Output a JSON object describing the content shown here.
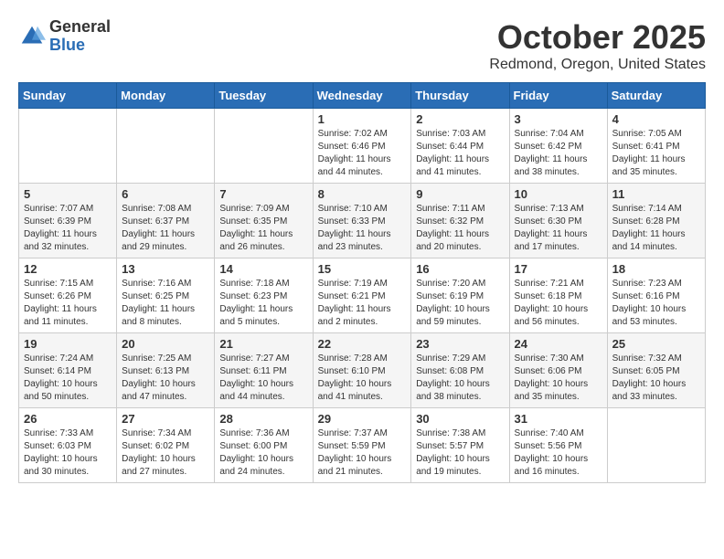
{
  "header": {
    "logo_general": "General",
    "logo_blue": "Blue",
    "month_title": "October 2025",
    "location": "Redmond, Oregon, United States"
  },
  "days_of_week": [
    "Sunday",
    "Monday",
    "Tuesday",
    "Wednesday",
    "Thursday",
    "Friday",
    "Saturday"
  ],
  "weeks": [
    [
      {
        "day": "",
        "sunrise": "",
        "sunset": "",
        "daylight": ""
      },
      {
        "day": "",
        "sunrise": "",
        "sunset": "",
        "daylight": ""
      },
      {
        "day": "",
        "sunrise": "",
        "sunset": "",
        "daylight": ""
      },
      {
        "day": "1",
        "sunrise": "Sunrise: 7:02 AM",
        "sunset": "Sunset: 6:46 PM",
        "daylight": "Daylight: 11 hours and 44 minutes."
      },
      {
        "day": "2",
        "sunrise": "Sunrise: 7:03 AM",
        "sunset": "Sunset: 6:44 PM",
        "daylight": "Daylight: 11 hours and 41 minutes."
      },
      {
        "day": "3",
        "sunrise": "Sunrise: 7:04 AM",
        "sunset": "Sunset: 6:42 PM",
        "daylight": "Daylight: 11 hours and 38 minutes."
      },
      {
        "day": "4",
        "sunrise": "Sunrise: 7:05 AM",
        "sunset": "Sunset: 6:41 PM",
        "daylight": "Daylight: 11 hours and 35 minutes."
      }
    ],
    [
      {
        "day": "5",
        "sunrise": "Sunrise: 7:07 AM",
        "sunset": "Sunset: 6:39 PM",
        "daylight": "Daylight: 11 hours and 32 minutes."
      },
      {
        "day": "6",
        "sunrise": "Sunrise: 7:08 AM",
        "sunset": "Sunset: 6:37 PM",
        "daylight": "Daylight: 11 hours and 29 minutes."
      },
      {
        "day": "7",
        "sunrise": "Sunrise: 7:09 AM",
        "sunset": "Sunset: 6:35 PM",
        "daylight": "Daylight: 11 hours and 26 minutes."
      },
      {
        "day": "8",
        "sunrise": "Sunrise: 7:10 AM",
        "sunset": "Sunset: 6:33 PM",
        "daylight": "Daylight: 11 hours and 23 minutes."
      },
      {
        "day": "9",
        "sunrise": "Sunrise: 7:11 AM",
        "sunset": "Sunset: 6:32 PM",
        "daylight": "Daylight: 11 hours and 20 minutes."
      },
      {
        "day": "10",
        "sunrise": "Sunrise: 7:13 AM",
        "sunset": "Sunset: 6:30 PM",
        "daylight": "Daylight: 11 hours and 17 minutes."
      },
      {
        "day": "11",
        "sunrise": "Sunrise: 7:14 AM",
        "sunset": "Sunset: 6:28 PM",
        "daylight": "Daylight: 11 hours and 14 minutes."
      }
    ],
    [
      {
        "day": "12",
        "sunrise": "Sunrise: 7:15 AM",
        "sunset": "Sunset: 6:26 PM",
        "daylight": "Daylight: 11 hours and 11 minutes."
      },
      {
        "day": "13",
        "sunrise": "Sunrise: 7:16 AM",
        "sunset": "Sunset: 6:25 PM",
        "daylight": "Daylight: 11 hours and 8 minutes."
      },
      {
        "day": "14",
        "sunrise": "Sunrise: 7:18 AM",
        "sunset": "Sunset: 6:23 PM",
        "daylight": "Daylight: 11 hours and 5 minutes."
      },
      {
        "day": "15",
        "sunrise": "Sunrise: 7:19 AM",
        "sunset": "Sunset: 6:21 PM",
        "daylight": "Daylight: 11 hours and 2 minutes."
      },
      {
        "day": "16",
        "sunrise": "Sunrise: 7:20 AM",
        "sunset": "Sunset: 6:19 PM",
        "daylight": "Daylight: 10 hours and 59 minutes."
      },
      {
        "day": "17",
        "sunrise": "Sunrise: 7:21 AM",
        "sunset": "Sunset: 6:18 PM",
        "daylight": "Daylight: 10 hours and 56 minutes."
      },
      {
        "day": "18",
        "sunrise": "Sunrise: 7:23 AM",
        "sunset": "Sunset: 6:16 PM",
        "daylight": "Daylight: 10 hours and 53 minutes."
      }
    ],
    [
      {
        "day": "19",
        "sunrise": "Sunrise: 7:24 AM",
        "sunset": "Sunset: 6:14 PM",
        "daylight": "Daylight: 10 hours and 50 minutes."
      },
      {
        "day": "20",
        "sunrise": "Sunrise: 7:25 AM",
        "sunset": "Sunset: 6:13 PM",
        "daylight": "Daylight: 10 hours and 47 minutes."
      },
      {
        "day": "21",
        "sunrise": "Sunrise: 7:27 AM",
        "sunset": "Sunset: 6:11 PM",
        "daylight": "Daylight: 10 hours and 44 minutes."
      },
      {
        "day": "22",
        "sunrise": "Sunrise: 7:28 AM",
        "sunset": "Sunset: 6:10 PM",
        "daylight": "Daylight: 10 hours and 41 minutes."
      },
      {
        "day": "23",
        "sunrise": "Sunrise: 7:29 AM",
        "sunset": "Sunset: 6:08 PM",
        "daylight": "Daylight: 10 hours and 38 minutes."
      },
      {
        "day": "24",
        "sunrise": "Sunrise: 7:30 AM",
        "sunset": "Sunset: 6:06 PM",
        "daylight": "Daylight: 10 hours and 35 minutes."
      },
      {
        "day": "25",
        "sunrise": "Sunrise: 7:32 AM",
        "sunset": "Sunset: 6:05 PM",
        "daylight": "Daylight: 10 hours and 33 minutes."
      }
    ],
    [
      {
        "day": "26",
        "sunrise": "Sunrise: 7:33 AM",
        "sunset": "Sunset: 6:03 PM",
        "daylight": "Daylight: 10 hours and 30 minutes."
      },
      {
        "day": "27",
        "sunrise": "Sunrise: 7:34 AM",
        "sunset": "Sunset: 6:02 PM",
        "daylight": "Daylight: 10 hours and 27 minutes."
      },
      {
        "day": "28",
        "sunrise": "Sunrise: 7:36 AM",
        "sunset": "Sunset: 6:00 PM",
        "daylight": "Daylight: 10 hours and 24 minutes."
      },
      {
        "day": "29",
        "sunrise": "Sunrise: 7:37 AM",
        "sunset": "Sunset: 5:59 PM",
        "daylight": "Daylight: 10 hours and 21 minutes."
      },
      {
        "day": "30",
        "sunrise": "Sunrise: 7:38 AM",
        "sunset": "Sunset: 5:57 PM",
        "daylight": "Daylight: 10 hours and 19 minutes."
      },
      {
        "day": "31",
        "sunrise": "Sunrise: 7:40 AM",
        "sunset": "Sunset: 5:56 PM",
        "daylight": "Daylight: 10 hours and 16 minutes."
      },
      {
        "day": "",
        "sunrise": "",
        "sunset": "",
        "daylight": ""
      }
    ]
  ]
}
